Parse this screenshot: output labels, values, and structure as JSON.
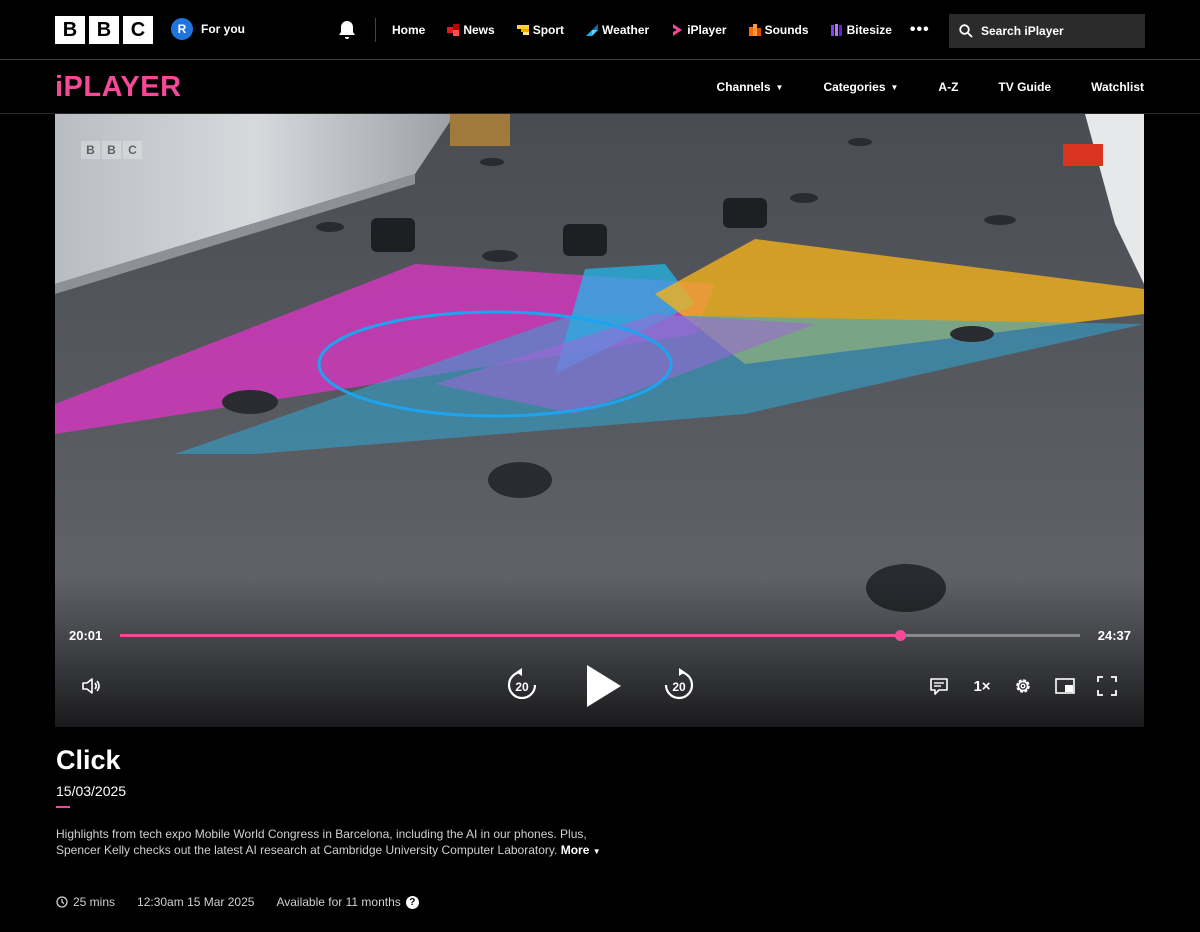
{
  "global_nav": {
    "logo_letters": [
      "B",
      "B",
      "C"
    ],
    "account": {
      "initial": "R",
      "label": "For you"
    },
    "items": [
      {
        "label": "Home",
        "icon": "none"
      },
      {
        "label": "News",
        "icon": "news-icon",
        "color": "#e21c1c"
      },
      {
        "label": "Sport",
        "icon": "sport-icon",
        "color": "#ffd230"
      },
      {
        "label": "Weather",
        "icon": "weather-icon",
        "color": "#18b4e8"
      },
      {
        "label": "iPlayer",
        "icon": "iplayer-icon",
        "color": "#f54997"
      },
      {
        "label": "Sounds",
        "icon": "sounds-icon",
        "color": "#ff6a00"
      },
      {
        "label": "Bitesize",
        "icon": "bitesize-icon",
        "color": "#8a3ffc"
      }
    ],
    "more_label": "•••",
    "search_placeholder": "Search iPlayer"
  },
  "iplayer_nav": {
    "logo": "iPLAYER",
    "items": [
      {
        "label": "Channels",
        "dropdown": true
      },
      {
        "label": "Categories",
        "dropdown": true
      },
      {
        "label": "A-Z",
        "dropdown": false
      },
      {
        "label": "TV Guide",
        "dropdown": false
      },
      {
        "label": "Watchlist",
        "dropdown": false
      }
    ]
  },
  "player": {
    "watermark": [
      "B",
      "B",
      "C"
    ],
    "current_time": "20:01",
    "duration": "24:37",
    "progress_fraction": 0.813,
    "rewind_seconds": "20",
    "forward_seconds": "20",
    "speed": "1×",
    "accent": "#f54997"
  },
  "programme": {
    "title": "Click",
    "date": "15/03/2025",
    "synopsis": "Highlights from tech expo Mobile World Congress in Barcelona, including the AI in our phones. Plus, Spencer Kelly checks out the latest AI research at Cambridge University Computer Laboratory.",
    "more_label": "More",
    "duration": "25 mins",
    "broadcast": "12:30am 15 Mar 2025",
    "availability": "Available for 11 months",
    "help_label": "?"
  }
}
